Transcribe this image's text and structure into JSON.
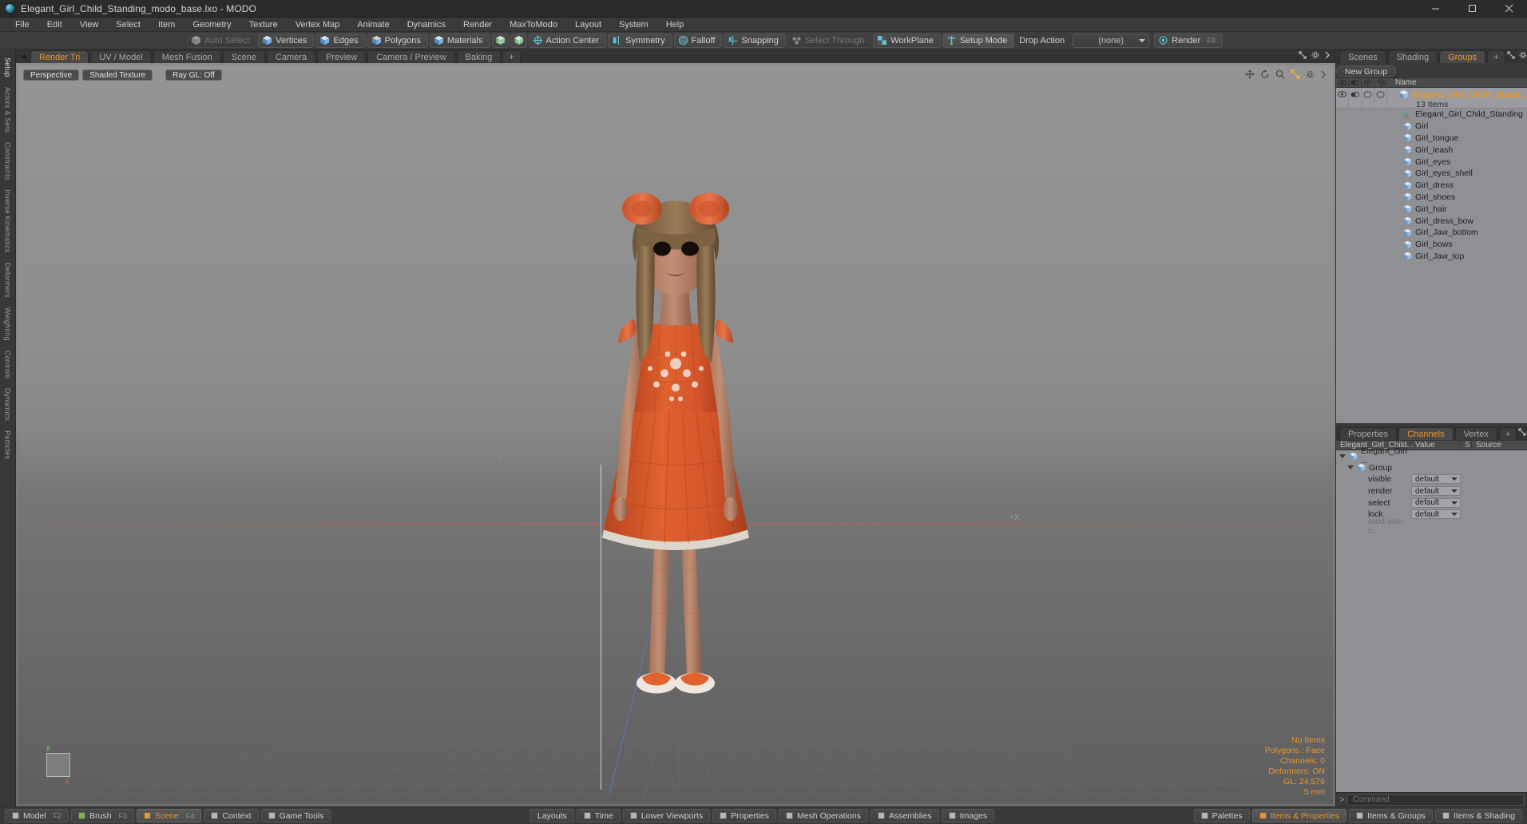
{
  "titlebar": {
    "title": "Elegant_Girl_Child_Standing_modo_base.lxo - MODO",
    "icon": "modo-app-icon",
    "minimize": "–",
    "maximize": "❐",
    "close": "✕"
  },
  "menubar": {
    "items": [
      "File",
      "Edit",
      "View",
      "Select",
      "Item",
      "Geometry",
      "Texture",
      "Vertex Map",
      "Animate",
      "Dynamics",
      "Render",
      "MaxToModo",
      "Layout",
      "System",
      "Help"
    ]
  },
  "modebar": {
    "auto_select": "Auto Select",
    "vertices": "Vertices",
    "edges": "Edges",
    "polygons": "Polygons",
    "materials": "Materials",
    "action_center": "Action Center",
    "symmetry": "Symmetry",
    "falloff": "Falloff",
    "snapping": "Snapping",
    "select_through": "Select Through",
    "workplane": "WorkPlane",
    "setup_mode": "Setup Mode",
    "drop_action": "Drop Action",
    "drop_action_value": "(none)",
    "render": "Render",
    "render_key": "F9"
  },
  "leftrail": {
    "items": [
      "Setup",
      "Actors & Sets",
      "Constraints",
      "Inverse Kinematics",
      "Deformers",
      "Weighting",
      "Controls",
      "Dynamics",
      "Particles"
    ]
  },
  "viewport_tabs": {
    "items": [
      "Render Tri",
      "UV / Model",
      "Mesh Fusion",
      "Scene",
      "Camera",
      "Preview",
      "Camera / Preview",
      "Baking"
    ],
    "active": "Render Tri",
    "add": "+"
  },
  "viewport": {
    "projection": "Perspective",
    "shading": "Shaded Texture",
    "raygl": "Ray GL: Off",
    "label_z": "Z",
    "label_px": "+X",
    "gizmo_y": "y",
    "gizmo_x": "x",
    "icons": [
      "move-icon",
      "rotate-icon",
      "zoom-icon",
      "fit-icon",
      "gear-icon",
      "chevron-right-icon"
    ],
    "stats": {
      "no_items": "No Items",
      "polygons": "Polygons : Face",
      "channels": "Channels: 0",
      "deformers": "Deformers: ON",
      "gl": "GL: 24,576",
      "units": "5 mm"
    }
  },
  "rightpanel": {
    "tabs": [
      "Scenes",
      "Shading",
      "Groups"
    ],
    "active_tab": "Groups",
    "add_tab": "+",
    "new_group": "New Group",
    "list_header": {
      "eye": "visibility-icon",
      "render": "render-icon",
      "select": "select-icon",
      "lock": "lock-icon",
      "name": "Name"
    },
    "group": {
      "name": "Elegant_Girl_Child_Stand...",
      "count": "13 Items"
    },
    "items": [
      "Elegant_Girl_Child_Standing",
      "Girl",
      "Girl_tongue",
      "Girl_leash",
      "Girl_eyes",
      "Girl_eyes_shell",
      "Girl_dress",
      "Girl_shoes",
      "Girl_hair",
      "Girl_dress_bow",
      "Girl_Jaw_bottom",
      "Girl_bows",
      "Girl_Jaw_top"
    ]
  },
  "channels": {
    "tabs": [
      "Properties",
      "Channels",
      "Vertex Maps"
    ],
    "active_tab": "Channels",
    "add_tab": "+",
    "columns": [
      "Elegant_Girl_Child...",
      "Value",
      "S",
      "Source"
    ],
    "root": "Elegant_Girl ...",
    "group": "Group",
    "rows": [
      {
        "name": "visible",
        "value": "default"
      },
      {
        "name": "render",
        "value": "default"
      },
      {
        "name": "select",
        "value": "default"
      },
      {
        "name": "lock",
        "value": "default"
      }
    ],
    "add_user": "(add user c..."
  },
  "commandbar": {
    "prompt": ">",
    "placeholder": "Command",
    "value": ""
  },
  "bottombar": {
    "left": [
      {
        "label": "Model",
        "key": "F2",
        "swatch": "grey"
      },
      {
        "label": "Brush",
        "key": "F3",
        "swatch": "grey"
      },
      {
        "label": "Scene",
        "key": "F4",
        "swatch": "orange",
        "active": true
      },
      {
        "label": "Context",
        "key": "",
        "swatch": "grey"
      },
      {
        "label": "Game Tools",
        "key": "",
        "swatch": "grey"
      }
    ],
    "center": [
      {
        "label": "Layouts"
      },
      {
        "label": "Time"
      },
      {
        "label": "Lower Viewports"
      },
      {
        "label": "Properties"
      },
      {
        "label": "Mesh Operations"
      },
      {
        "label": "Assemblies"
      },
      {
        "label": "Images"
      }
    ],
    "right": [
      {
        "label": "Palettes",
        "active": false
      },
      {
        "label": "Items & Properties",
        "active": true
      },
      {
        "label": "Items & Groups",
        "active": false
      },
      {
        "label": "Items & Shading",
        "active": false
      }
    ]
  },
  "colors": {
    "accent": "#e8962e",
    "panel_bg": "#3a3a3a",
    "list_bg": "#8f9094",
    "dress": "#d9582f"
  }
}
